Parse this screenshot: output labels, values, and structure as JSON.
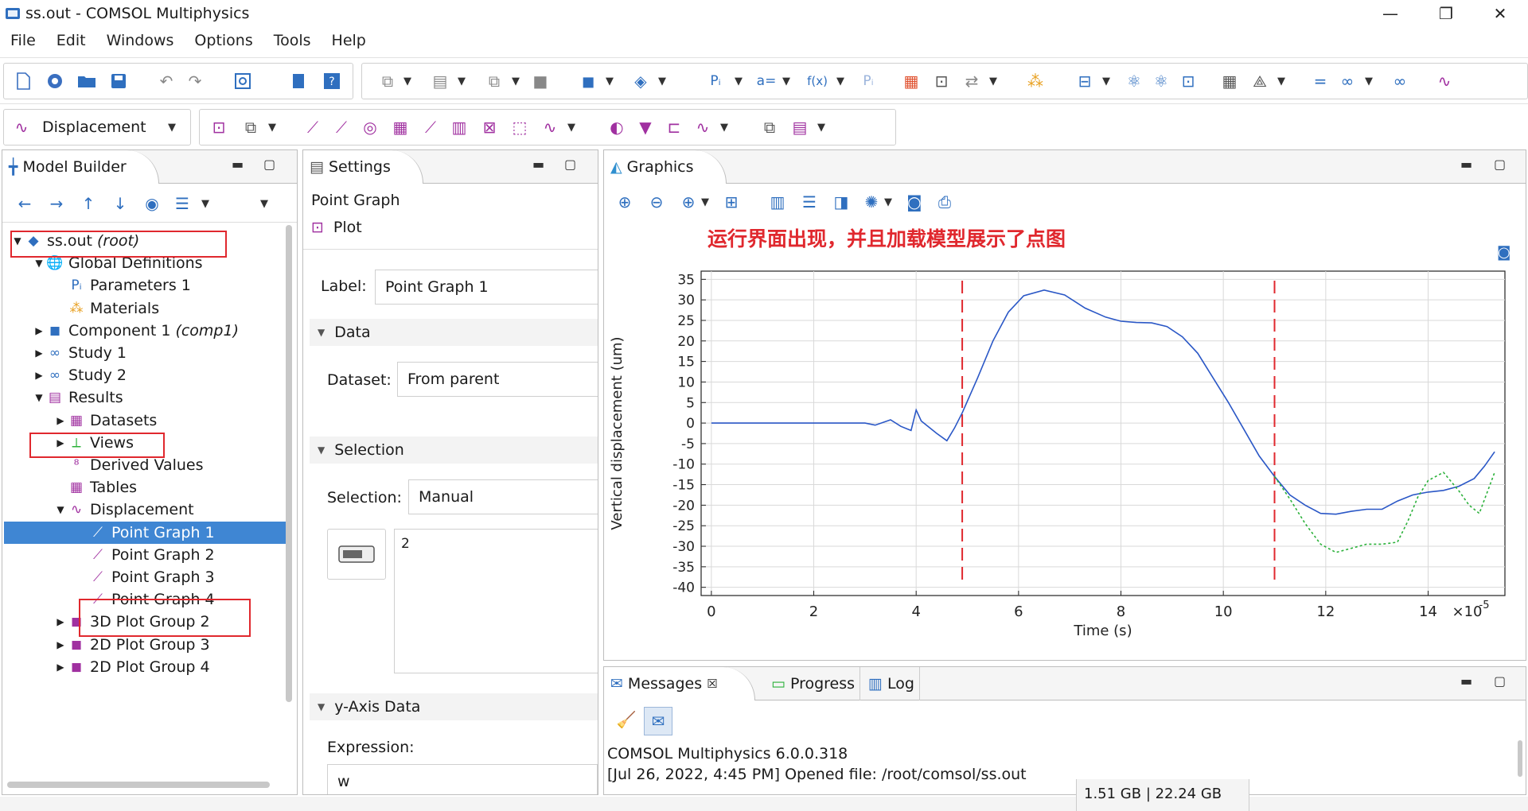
{
  "window": {
    "title": "ss.out - COMSOL Multiphysics",
    "minimize": "—",
    "restore": "❐",
    "close": "✕"
  },
  "menu": [
    "File",
    "Edit",
    "Windows",
    "Options",
    "Tools",
    "Help"
  ],
  "toolbar2": {
    "plot_group_select": "Displacement"
  },
  "model_builder": {
    "tab": "Model Builder",
    "tree": [
      {
        "label": "ss.out",
        "suffix": "(root)",
        "level": 0,
        "expanded": true,
        "icon": "root-icon"
      },
      {
        "label": "Global Definitions",
        "suffix": "",
        "level": 1,
        "expanded": true,
        "icon": "globe-icon"
      },
      {
        "label": "Parameters 1",
        "suffix": "",
        "level": 2,
        "icon": "parameters-icon"
      },
      {
        "label": "Materials",
        "suffix": "",
        "level": 2,
        "icon": "materials-icon"
      },
      {
        "label": "Component 1",
        "suffix": "(comp1)",
        "level": 1,
        "expanded": false,
        "icon": "component-icon"
      },
      {
        "label": "Study 1",
        "suffix": "",
        "level": 1,
        "expanded": false,
        "icon": "study-icon"
      },
      {
        "label": "Study 2",
        "suffix": "",
        "level": 1,
        "expanded": false,
        "icon": "study-icon"
      },
      {
        "label": "Results",
        "suffix": "",
        "level": 1,
        "expanded": true,
        "icon": "results-icon"
      },
      {
        "label": "Datasets",
        "suffix": "",
        "level": 2,
        "expanded": false,
        "icon": "datasets-icon"
      },
      {
        "label": "Views",
        "suffix": "",
        "level": 2,
        "expanded": false,
        "icon": "views-icon"
      },
      {
        "label": "Derived Values",
        "suffix": "",
        "level": 2,
        "icon": "derived-values-icon"
      },
      {
        "label": "Tables",
        "suffix": "",
        "level": 2,
        "icon": "tables-icon"
      },
      {
        "label": "Displacement",
        "suffix": "",
        "level": 2,
        "expanded": true,
        "icon": "plot-group-icon"
      },
      {
        "label": "Point Graph 1",
        "suffix": "",
        "level": 3,
        "selected": true,
        "icon": "point-graph-icon"
      },
      {
        "label": "Point Graph 2",
        "suffix": "",
        "level": 3,
        "icon": "point-graph-icon"
      },
      {
        "label": "Point Graph 3",
        "suffix": "",
        "level": 3,
        "icon": "point-graph-icon"
      },
      {
        "label": "Point Graph 4",
        "suffix": "",
        "level": 3,
        "icon": "point-graph-icon"
      },
      {
        "label": "3D Plot Group 2",
        "suffix": "",
        "level": 2,
        "expanded": false,
        "icon": "3d-plot-icon"
      },
      {
        "label": "2D Plot Group 3",
        "suffix": "",
        "level": 2,
        "expanded": false,
        "icon": "2d-plot-icon"
      },
      {
        "label": "2D Plot Group 4",
        "suffix": "",
        "level": 2,
        "expanded": false,
        "icon": "2d-plot-icon"
      }
    ]
  },
  "settings": {
    "tab": "Settings",
    "node_type": "Point Graph",
    "plot_button": "Plot",
    "label_caption": "Label:",
    "label_value": "Point Graph 1",
    "data_section": "Data",
    "dataset_caption": "Dataset:",
    "dataset_value": "From parent",
    "selection_section": "Selection",
    "selection_caption": "Selection:",
    "selection_value": "Manual",
    "selection_list_item": "2",
    "yaxis_section": "y-Axis Data",
    "expression_caption": "Expression:",
    "expression_value": "w"
  },
  "graphics": {
    "tab": "Graphics",
    "annotation": "运行界面出现，并且加载模型展示了点图"
  },
  "chart_data": {
    "type": "line",
    "xlabel": "Time (s)",
    "ylabel": "Vertical displacement (um)",
    "x_multiplier_label": "×10",
    "x_multiplier_exp": "-5",
    "xlim": [
      -0.2,
      15.5
    ],
    "ylim": [
      -42,
      37
    ],
    "xticks": [
      0,
      2,
      4,
      6,
      8,
      10,
      12,
      14
    ],
    "yticks": [
      35,
      30,
      25,
      20,
      15,
      10,
      5,
      0,
      -5,
      -10,
      -15,
      -20,
      -25,
      -30,
      -35,
      -40
    ],
    "grid": true,
    "series": [
      {
        "style": "solid",
        "color": "#2a57c6",
        "x": [
          0,
          1,
          2,
          3,
          3.2,
          3.5,
          3.7,
          3.9,
          4.0,
          4.1,
          4.4,
          4.6,
          4.75,
          4.9,
          5.2,
          5.5,
          5.8,
          6.1,
          6.5,
          6.9,
          7.3,
          7.7,
          8.0,
          8.3,
          8.6,
          8.9,
          9.2,
          9.5,
          9.8,
          10.1,
          10.4,
          10.7,
          11.0,
          11.3,
          11.6,
          11.9,
          12.2,
          12.5,
          12.8,
          13.1,
          13.4,
          13.7,
          14.0,
          14.3,
          14.6,
          14.9,
          15.1,
          15.3
        ],
        "y": [
          0,
          0,
          0,
          0,
          -0.5,
          0.8,
          -0.8,
          -1.8,
          3.2,
          0.5,
          -2.5,
          -4.3,
          -1.2,
          2.5,
          11,
          20,
          27,
          31,
          32.4,
          31.2,
          28,
          25.8,
          24.8,
          24.5,
          24.4,
          23.5,
          21,
          17,
          11,
          5,
          -1.5,
          -8,
          -13,
          -17.5,
          -20,
          -22,
          -22.2,
          -21.5,
          -21,
          -21,
          -19,
          -17.5,
          -16.8,
          -16.4,
          -15.4,
          -13.5,
          -10.5,
          -7
        ]
      },
      {
        "style": "dotted",
        "color": "#2bb13a",
        "x": [
          11.0,
          11.3,
          11.6,
          11.9,
          12.2,
          12.5,
          12.8,
          13.1,
          13.4,
          13.6,
          13.8,
          14.0,
          14.3,
          14.6,
          14.8,
          15.0,
          15.3
        ],
        "y": [
          -13,
          -18.5,
          -24.5,
          -29.5,
          -31.5,
          -30.5,
          -29.5,
          -29.5,
          -29,
          -24,
          -18,
          -14,
          -12,
          -16.5,
          -20,
          -22,
          -12
        ]
      }
    ],
    "reference_lines": [
      {
        "x": 4.9,
        "color": "#e0282e",
        "style": "dashed"
      },
      {
        "x": 11.0,
        "color": "#e0282e",
        "style": "dashed"
      }
    ]
  },
  "messages": {
    "tab_messages": "Messages",
    "tab_progress": "Progress",
    "tab_log": "Log",
    "line1": "COMSOL Multiphysics 6.0.0.318",
    "line2": "[Jul 26, 2022, 4:45 PM] Opened file: /root/comsol/ss.out"
  },
  "status_bar": {
    "memory": "1.51 GB | 22.24 GB"
  }
}
